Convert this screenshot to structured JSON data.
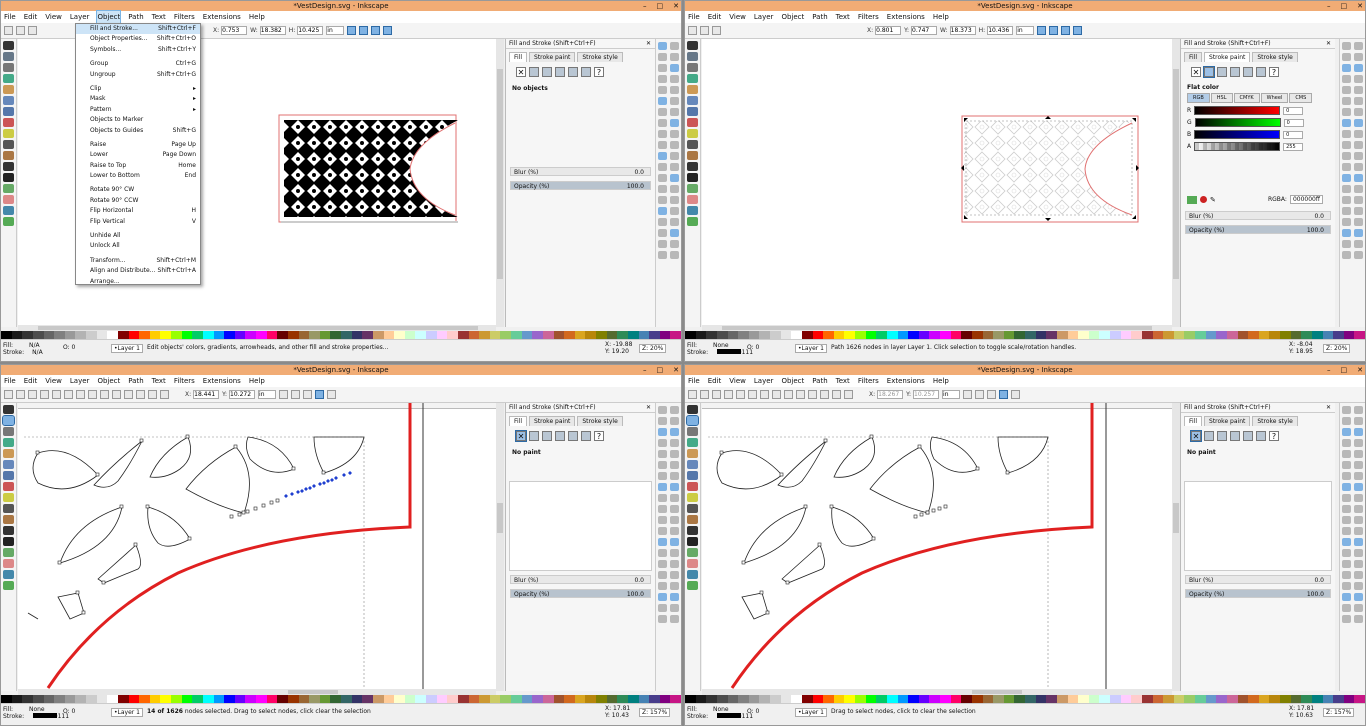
{
  "window_title": "*VestDesign.svg - Inkscape",
  "window_controls": [
    "–",
    "□",
    "✕"
  ],
  "menu": [
    "File",
    "Edit",
    "View",
    "Layer",
    "Object",
    "Path",
    "Text",
    "Filters",
    "Extensions",
    "Help"
  ],
  "colors": {
    "titlebar": "#f1ac75",
    "menu_highlight": "#cde4f7",
    "selection_blue": "#7fb2e3",
    "guide_red": "#e02020"
  },
  "panel": {
    "title": "Fill and Stroke (Shift+Ctrl+F)",
    "tabs": [
      "Fill",
      "Stroke paint",
      "Stroke style"
    ],
    "blur_label": "Blur (%)",
    "opacity_label": "Opacity (%)",
    "opacity_value": "100.0"
  },
  "object_menu": [
    {
      "label": "Fill and Stroke...",
      "shortcut": "Shift+Ctrl+F",
      "highlight": true
    },
    {
      "label": "Object Properties...",
      "shortcut": "Shift+Ctrl+O"
    },
    {
      "label": "Symbols...",
      "shortcut": "Shift+Ctrl+Y"
    },
    {
      "sep": true
    },
    {
      "label": "Group",
      "shortcut": "Ctrl+G"
    },
    {
      "label": "Ungroup",
      "shortcut": "Shift+Ctrl+G"
    },
    {
      "sep": true
    },
    {
      "label": "Clip",
      "shortcut": "▸"
    },
    {
      "label": "Mask",
      "shortcut": "▸"
    },
    {
      "label": "Pattern",
      "shortcut": "▸"
    },
    {
      "label": "Objects to Marker",
      "shortcut": ""
    },
    {
      "label": "Objects to Guides",
      "shortcut": "Shift+G"
    },
    {
      "sep": true
    },
    {
      "label": "Raise",
      "shortcut": "Page Up"
    },
    {
      "label": "Lower",
      "shortcut": "Page Down"
    },
    {
      "label": "Raise to Top",
      "shortcut": "Home"
    },
    {
      "label": "Lower to Bottom",
      "shortcut": "End"
    },
    {
      "sep": true
    },
    {
      "label": "Rotate 90° CW",
      "shortcut": ""
    },
    {
      "label": "Rotate 90° CCW",
      "shortcut": ""
    },
    {
      "label": "Flip Horizontal",
      "shortcut": "H"
    },
    {
      "label": "Flip Vertical",
      "shortcut": "V"
    },
    {
      "sep": true
    },
    {
      "label": "Unhide All",
      "shortcut": ""
    },
    {
      "label": "Unlock All",
      "shortcut": ""
    },
    {
      "sep": true
    },
    {
      "label": "Transform...",
      "shortcut": "Shift+Ctrl+M"
    },
    {
      "label": "Align and Distribute...",
      "shortcut": "Shift+Ctrl+A"
    },
    {
      "label": "Arrange...",
      "shortcut": ""
    }
  ],
  "quadrants": [
    {
      "ctrl": {
        "x": "0.753",
        "w": "18.382",
        "h": "10.425",
        "unit": "in"
      },
      "msg_text": "No objects",
      "blur_value": "0.0",
      "status": {
        "fill": "N/A",
        "stroke": "N/A",
        "o": "0",
        "layer": "•Layer 1",
        "message": "Edit objects' colors, gradients, arrowheads, and other fill and stroke properties...",
        "x": "X: -19.88",
        "y": "Y: 19.20",
        "z": "20%"
      }
    },
    {
      "ctrl": {
        "x": "0.801",
        "y": "0.747",
        "w": "18.373",
        "h": "10.436",
        "unit": "in"
      },
      "flat_color": "Flat color",
      "color_modes": [
        "RGB",
        "HSL",
        "CMYK",
        "Wheel",
        "CMS"
      ],
      "channels": [
        {
          "label": "R",
          "value": "0"
        },
        {
          "label": "G",
          "value": "0"
        },
        {
          "label": "B",
          "value": "0"
        },
        {
          "label": "A",
          "value": "255"
        }
      ],
      "rgba_label": "RGBA:",
      "rgba_value": "000000ff",
      "blur_value": "0.0",
      "status": {
        "fill": "None",
        "stroke": "0.0111",
        "o": "0",
        "layer": "•Layer 1",
        "message": "Path 1626 nodes in layer Layer 1. Click selection to toggle scale/rotation handles.",
        "x": "X: -8.04",
        "y": "Y: 18.95",
        "z": "20%"
      }
    },
    {
      "ctrl": {
        "x": "18.441",
        "y": "10.272",
        "unit": "in"
      },
      "msg_text": "No paint",
      "blur_value": "0.0",
      "status": {
        "fill": "None",
        "stroke": "0.0111",
        "o": "0",
        "layer": "•Layer 1",
        "message_bold": "14 of 1626",
        "message": "nodes selected. Drag to select nodes, click clear the selection",
        "x": "X: 17.81",
        "y": "Y: 10.43",
        "z": "157%"
      }
    },
    {
      "ctrl": {
        "x": "18.267",
        "y": "10.257",
        "unit": "in"
      },
      "msg_text": "No paint",
      "blur_value": "0.0",
      "status": {
        "fill": "None",
        "stroke": "0.0111",
        "o": "0",
        "layer": "•Layer 1",
        "message": "Drag to select nodes, click to clear the selection",
        "x": "X: 17.81",
        "y": "Y: 10.63",
        "z": "157%"
      }
    }
  ]
}
